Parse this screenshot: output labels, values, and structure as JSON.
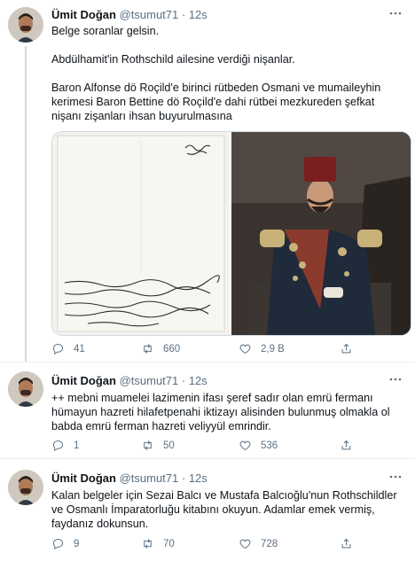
{
  "tweets": [
    {
      "name": "Ümit Doğan",
      "handle": "@tsumut71",
      "time": "· 12s",
      "text_lines": [
        "Belge soranlar gelsin.",
        "",
        "Abdülhamit'in Rothschild ailesine verdiği nişanlar.",
        "",
        "Baron Alfonse dö Roçild'e birinci rütbeden Osmani ve mumaileyhin kerimesi Baron Bettine dö Roçild'e dahi rütbei mezkureden şefkat nişanı zişanları ihsan buyurulmasına"
      ],
      "replies": "41",
      "retweets": "660",
      "likes": "2,9 B"
    },
    {
      "name": "Ümit Doğan",
      "handle": "@tsumut71",
      "time": "· 12s",
      "text": "++ mebni muamelei lazimenin ifası şeref sadır olan emrü fermanı hümayun hazreti hilafetpenahi iktizayı alisinden bulunmuş olmakla ol babda emrü ferman hazreti veliyyül emrindir.",
      "replies": "1",
      "retweets": "50",
      "likes": "536"
    },
    {
      "name": "Ümit Doğan",
      "handle": "@tsumut71",
      "time": "· 12s",
      "text": "Kalan belgeler için Sezai Balcı ve Mustafa Balcıoğlu'nun Rothschildler ve Osmanlı İmparatorluğu kitabını okuyun. Adamlar emek vermiş, faydanız dokunsun.",
      "replies": "9",
      "retweets": "70",
      "likes": "728"
    }
  ],
  "icons": {
    "reply": "reply-icon",
    "retweet": "retweet-icon",
    "like": "heart-icon",
    "share": "share-icon",
    "more": "more-icon"
  }
}
